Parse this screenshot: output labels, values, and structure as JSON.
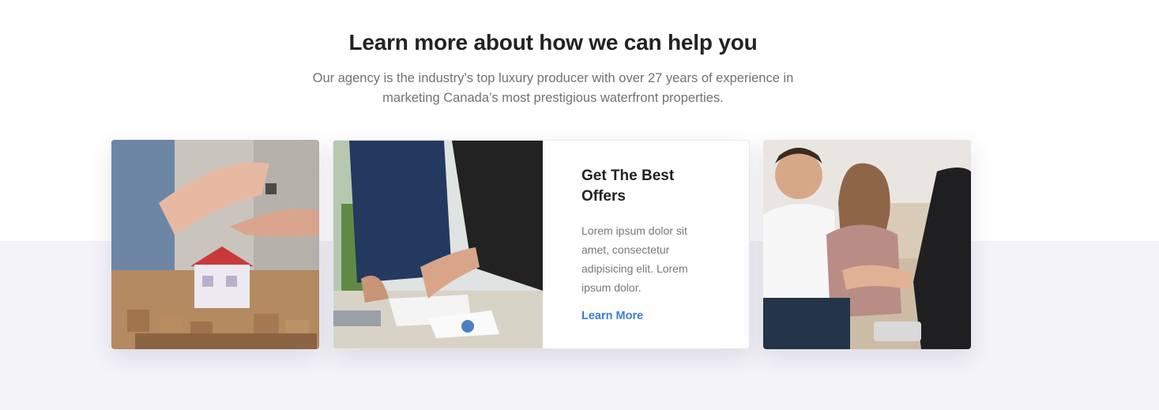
{
  "section": {
    "heading": "Learn more about how we can help you",
    "subtext_line1": "Our agency is the industry’s top luxury producer with over 27 years of experience in",
    "subtext_line2": "marketing Canada’s most prestigious waterfront properties."
  },
  "cards": [
    {
      "image": "house-keys-photo"
    },
    {
      "image": "business-meeting-photo",
      "title_line1": "Get The Best",
      "title_line2": "Offers",
      "text_line1": "Lorem ipsum dolor sit",
      "text_line2": "amet, consectetur",
      "text_line3": "adipisicing elit. Lorem",
      "text_line4": "ipsum dolor.",
      "link_label": "Learn More"
    },
    {
      "image": "couple-handshake-photo"
    }
  ],
  "colors": {
    "heading": "#222222",
    "body_text": "#777777",
    "link": "#3f7bd6",
    "lower_background": "#f4f3f8"
  }
}
